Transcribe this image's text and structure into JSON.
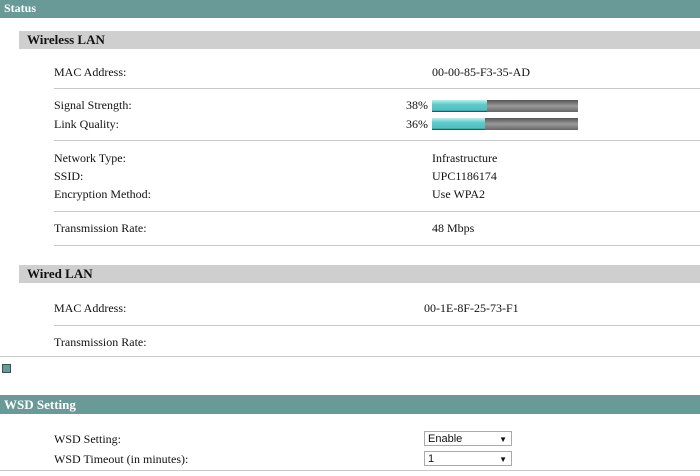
{
  "status_title": "Status",
  "wireless": {
    "title": "Wireless LAN",
    "mac_label": "MAC Address:",
    "mac": "00-00-85-F3-35-AD",
    "signal_label": "Signal Strength:",
    "signal_text": "38%",
    "signal_pct": 38,
    "link_label": "Link Quality:",
    "link_text": "36%",
    "link_pct": 36,
    "nettype_label": "Network Type:",
    "nettype": "Infrastructure",
    "ssid_label": "SSID:",
    "ssid": "UPC1186174",
    "enc_label": "Encryption Method:",
    "enc": "Use WPA2",
    "rate_label": "Transmission Rate:",
    "rate": "48 Mbps"
  },
  "wired": {
    "title": "Wired LAN",
    "mac_label": "MAC Address:",
    "mac": "00-1E-8F-25-73-F1",
    "rate_label": "Transmission Rate:"
  },
  "wsd": {
    "title": "WSD Setting",
    "setting_label": "WSD Setting:",
    "setting": "Enable",
    "timeout_label": "WSD Timeout (in minutes):",
    "timeout": "1"
  }
}
